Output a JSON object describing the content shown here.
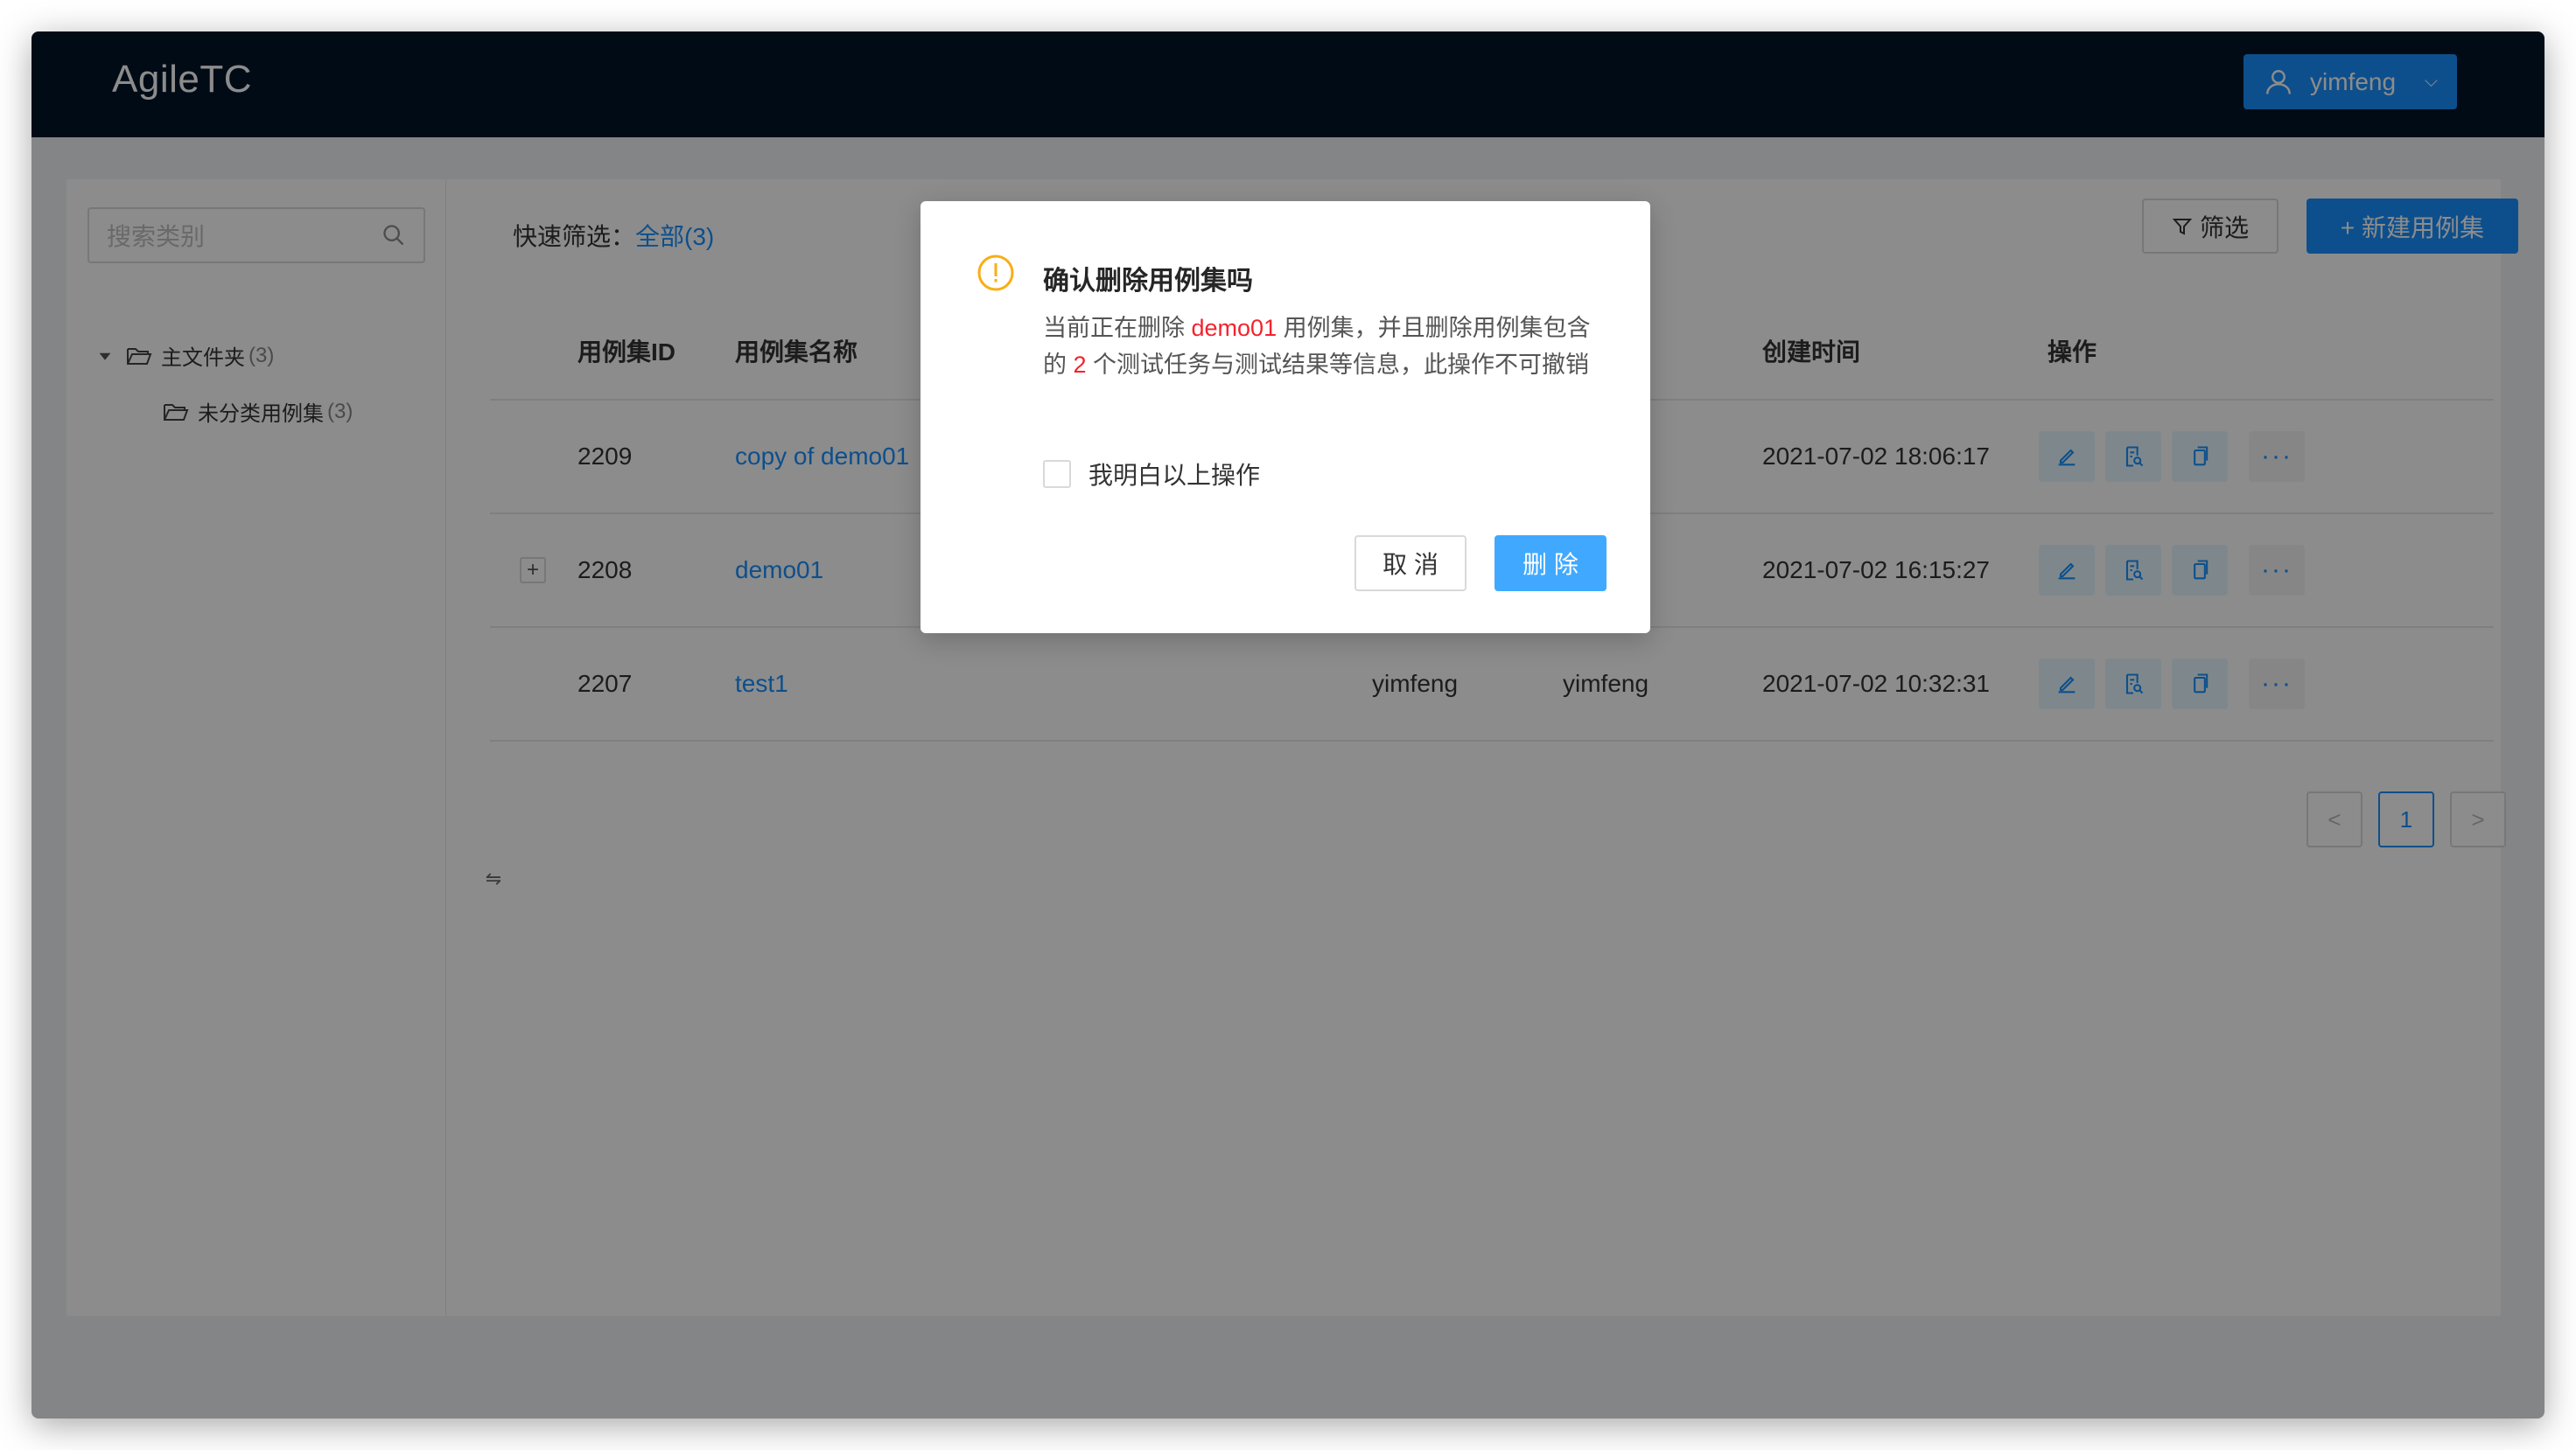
{
  "app": {
    "logo": "AgileTC"
  },
  "header": {
    "user": "yimfeng"
  },
  "sidebar": {
    "search_placeholder": "搜索类别",
    "tree": [
      {
        "label": "主文件夹",
        "count": "(3)"
      },
      {
        "label": "未分类用例集",
        "count": "(3)"
      }
    ]
  },
  "collapse_glyph": "⇋",
  "toolbar": {
    "quick_label": "快速筛选：",
    "quick_all": "全部(3)",
    "filter": "筛选",
    "new_case": "+ 新建用例集"
  },
  "table": {
    "headers": {
      "id": "用例集ID",
      "name": "用例集名称",
      "created": "创建时间",
      "ops": "操作"
    },
    "rows": [
      {
        "id": "2209",
        "name": "copy of demo01",
        "creator": "",
        "modifier": "",
        "created": "2021-07-02 18:06:17"
      },
      {
        "id": "2208",
        "name": "demo01",
        "creator": "",
        "modifier": "",
        "created": "2021-07-02 16:15:27"
      },
      {
        "id": "2207",
        "name": "test1",
        "creator": "yimfeng",
        "modifier": "yimfeng",
        "created": "2021-07-02 10:32:31"
      }
    ],
    "more_glyph": "···",
    "expand_glyph": "+"
  },
  "pagination": {
    "prev": "<",
    "current": "1",
    "next": ">"
  },
  "modal": {
    "title": "确认删除用例集吗",
    "body_1": "当前正在删除 ",
    "body_case": "demo01",
    "body_2": " 用例集，并且删除用例集包含的 ",
    "body_count": "2",
    "body_3": " 个测试任务与测试结果等信息，此操作不可撤销",
    "checkbox_label": "我明白以上操作",
    "cancel": "取 消",
    "delete": "删 除"
  },
  "colors": {
    "header": "#001529",
    "primary": "#1890ff",
    "danger": "#f5222d",
    "warning": "#faad14"
  }
}
